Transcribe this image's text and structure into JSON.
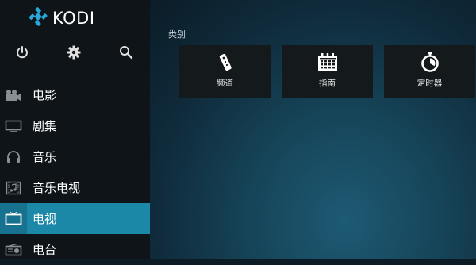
{
  "app": {
    "logo_text": "KODI"
  },
  "toolbar": [
    {
      "icon": "power-icon"
    },
    {
      "icon": "gear-icon"
    },
    {
      "icon": "search-icon"
    }
  ],
  "sidebar": {
    "items": [
      {
        "label": "电影",
        "icon": "movie-camera-icon"
      },
      {
        "label": "剧集",
        "icon": "monitor-icon"
      },
      {
        "label": "音乐",
        "icon": "headphones-icon"
      },
      {
        "label": "音乐电视",
        "icon": "music-video-icon"
      },
      {
        "label": "电视",
        "icon": "tv-icon",
        "active": true
      },
      {
        "label": "电台",
        "icon": "radio-icon"
      }
    ]
  },
  "main": {
    "category_title": "类别",
    "tiles": [
      {
        "label": "频道",
        "icon": "remote-icon"
      },
      {
        "label": "指南",
        "icon": "calendar-icon"
      },
      {
        "label": "定时器",
        "icon": "timer-icon"
      }
    ]
  },
  "colors": {
    "accent": "#1c88a7",
    "sidebar_bg": "#0e1418",
    "tile_bg": "#14191c"
  }
}
